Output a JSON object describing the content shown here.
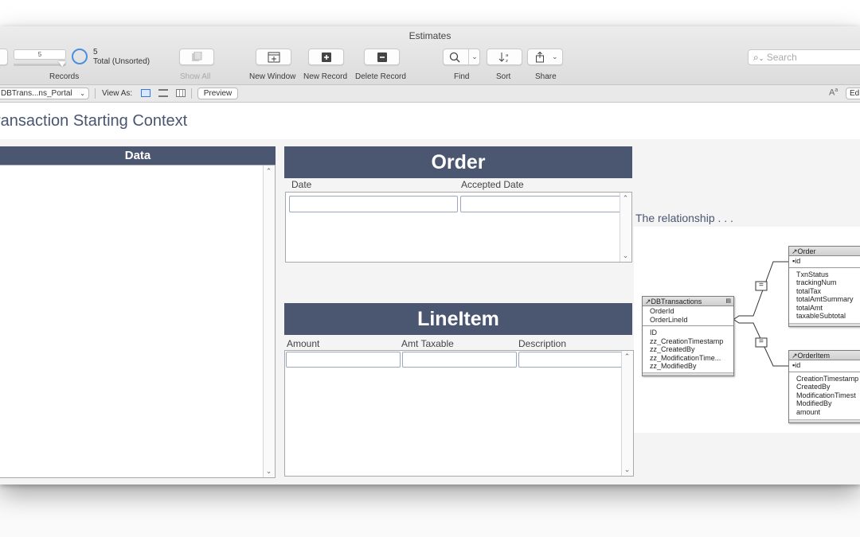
{
  "window": {
    "title": "Estimates"
  },
  "toolbar": {
    "records_value": "5",
    "records_label": "Records",
    "found_count": "5",
    "found_status": "Total (Unsorted)",
    "show_all_label": "Show All",
    "new_window_label": "New Window",
    "new_record_label": "New Record",
    "delete_record_label": "Delete Record",
    "find_label": "Find",
    "sort_label": "Sort",
    "share_label": "Share",
    "search_placeholder": "Search"
  },
  "layout_bar": {
    "layout_name": "DBTrans...ns_Portal",
    "view_as_label": "View As:",
    "preview_label": "Preview",
    "edit_label": "Ed"
  },
  "page": {
    "heading": "ransaction Starting Context",
    "data_panel_title": "Data",
    "order_title": "Order",
    "order_columns": [
      "Date",
      "Accepted Date"
    ],
    "lineitem_title": "LineItem",
    "lineitem_columns": [
      "Amount",
      "Amt Taxable",
      "Description"
    ],
    "relationship_label": "The relationship . . ."
  },
  "relationship_graph": {
    "dbtransactions": {
      "name": "DBTransactions",
      "keys": [
        "OrderId",
        "OrderLineId"
      ],
      "fields": [
        "ID",
        "zz_CreationTimestamp",
        "zz_CreatedBy",
        "zz_ModificationTime...",
        "zz_ModifiedBy"
      ]
    },
    "order": {
      "name": "Order",
      "keys": [
        "id"
      ],
      "fields": [
        "TxnStatus",
        "trackingNum",
        "totalTax",
        "totalAmtSummary",
        "totalAmt",
        "taxableSubtotal"
      ]
    },
    "orderitem": {
      "name": "OrderItem",
      "keys": [
        "id"
      ],
      "fields": [
        "CreationTimestamp",
        "CreatedBy",
        "ModificationTimest",
        "ModifiedBy",
        "amount"
      ]
    },
    "join_symbol": "="
  }
}
